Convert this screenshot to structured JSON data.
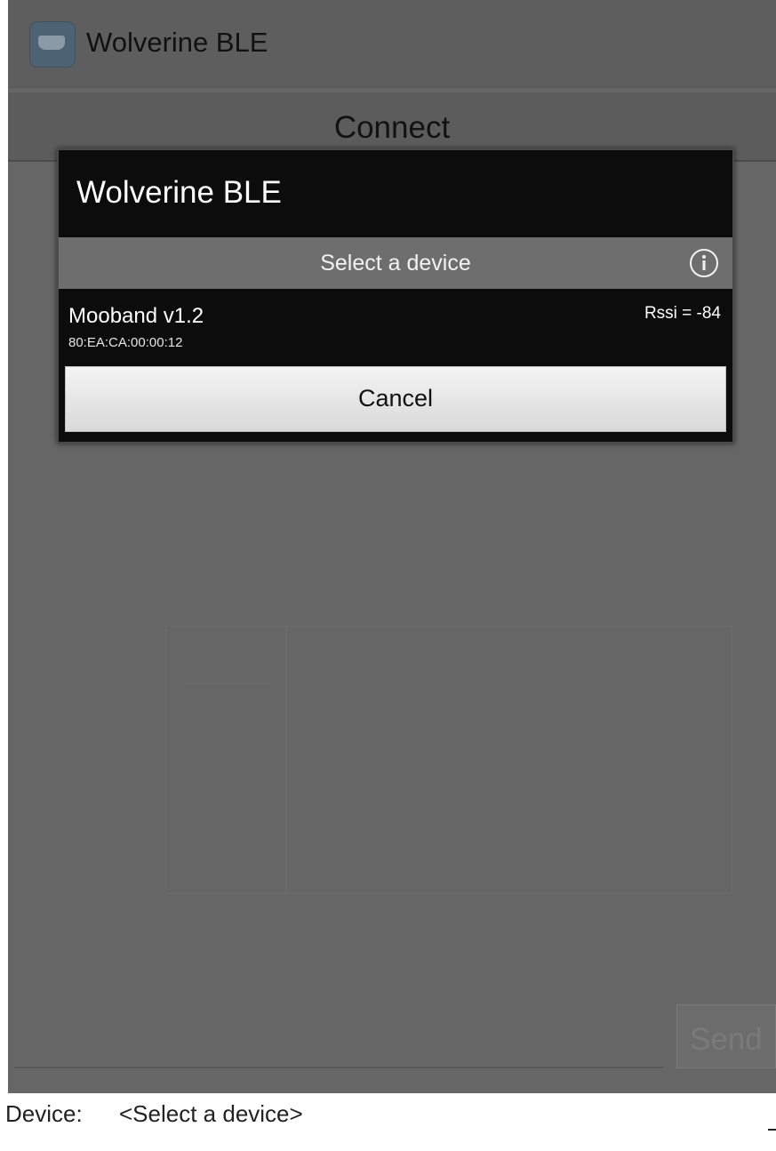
{
  "app": {
    "title": "Wolverine BLE",
    "icon": "serial-port-icon"
  },
  "main": {
    "connect_label": "Connect",
    "send_label": "Send",
    "device_label": "Device:",
    "device_value": "<Select a device>"
  },
  "dialog": {
    "title": "Wolverine BLE",
    "header": "Select a device",
    "info_icon": "info-icon",
    "devices": [
      {
        "name": "Mooband v1.2",
        "address": "80:EA:CA:00:00:12",
        "rssi": "Rssi = -84"
      }
    ],
    "cancel_label": "Cancel"
  },
  "colors": {
    "dim_background": "#666666",
    "dialog_background": "#0c0c0c",
    "dialog_header": "#6e6e6e",
    "text_on_dark": "#ffffff"
  }
}
